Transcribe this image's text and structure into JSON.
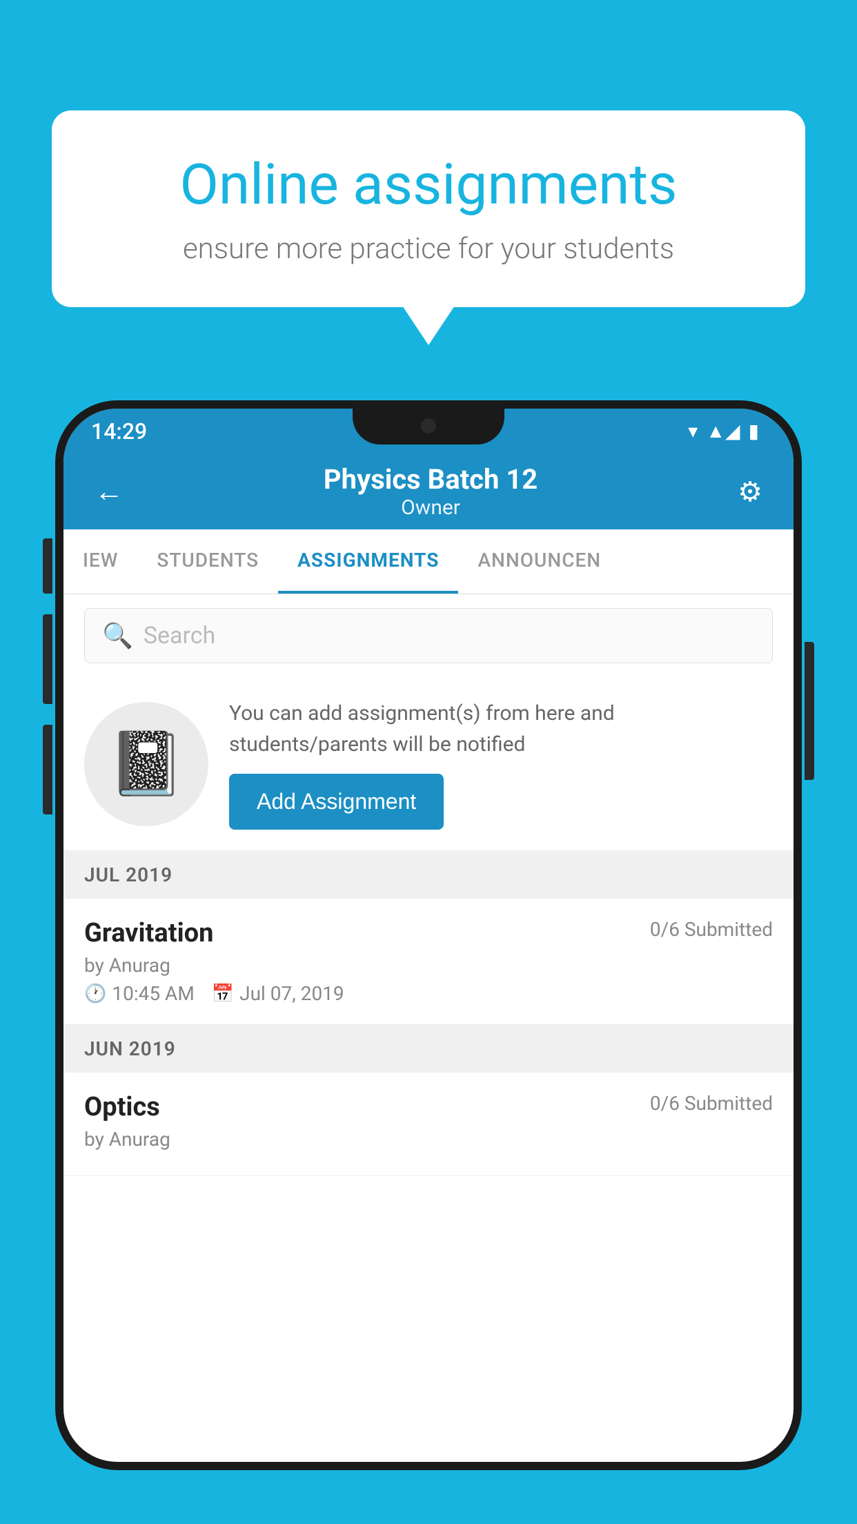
{
  "promo": {
    "title": "Online assignments",
    "subtitle": "ensure more practice for your students"
  },
  "status_bar": {
    "time": "14:29",
    "wifi": "▾",
    "signal": "▲",
    "battery": "▮"
  },
  "header": {
    "title": "Physics Batch 12",
    "subtitle": "Owner",
    "back_label": "←",
    "settings_label": "⚙"
  },
  "tabs": [
    {
      "label": "IEW",
      "active": false
    },
    {
      "label": "STUDENTS",
      "active": false
    },
    {
      "label": "ASSIGNMENTS",
      "active": true
    },
    {
      "label": "ANNOUNCEN",
      "active": false
    }
  ],
  "search": {
    "placeholder": "Search"
  },
  "add_section": {
    "text": "You can add assignment(s) from here and students/parents will be notified",
    "button_label": "Add Assignment"
  },
  "sections": [
    {
      "header": "JUL 2019",
      "assignments": [
        {
          "title": "Gravitation",
          "submitted": "0/6 Submitted",
          "author": "by Anurag",
          "time": "10:45 AM",
          "date": "Jul 07, 2019"
        }
      ]
    },
    {
      "header": "JUN 2019",
      "assignments": [
        {
          "title": "Optics",
          "submitted": "0/6 Submitted",
          "author": "by Anurag",
          "time": "",
          "date": ""
        }
      ]
    }
  ],
  "colors": {
    "primary": "#1c8fc4",
    "background": "#18b4e0",
    "text_dark": "#222",
    "text_muted": "#888"
  }
}
